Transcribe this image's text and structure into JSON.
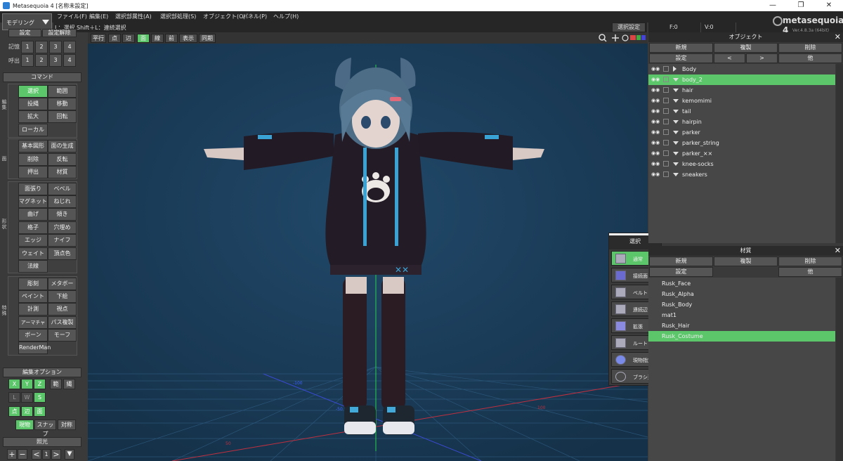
{
  "window": {
    "title": "Metasequoia 4 [名称未設定]",
    "minimize": "—",
    "restore": "❐",
    "close": "✕"
  },
  "menu": [
    "ファイル(F)",
    "編集(E)",
    "選択部属性(A)",
    "選択部処理(S)",
    "オブジェクト(O)",
    "パネル(P)",
    "ヘルプ(H)"
  ],
  "mode": {
    "label": "モデリング"
  },
  "status": {
    "hint": "L：選択  Shift＋L：連続選択",
    "settings_button": "選択設定"
  },
  "frame": {
    "f_label": "F:0",
    "v_label": "V:0"
  },
  "logo": {
    "text": "metasequoia 4",
    "version": "Ver.4.8.3a (64bit)"
  },
  "left": {
    "top_buttons": [
      "設定",
      "設定解除"
    ],
    "memory_label": "記憶",
    "recall_label": "呼出",
    "slots": [
      "1",
      "2",
      "3",
      "4"
    ],
    "command_header": "コマンド",
    "group1_label": "編集",
    "group1": [
      "選択",
      "範囲",
      "投縄",
      "移動",
      "拡大",
      "回転",
      "ローカル"
    ],
    "group2_label": "面",
    "group2": [
      "基本図形",
      "面の生成",
      "削除",
      "反転",
      "押出",
      "材質"
    ],
    "group3_label": "形状",
    "group3": [
      "面張り",
      "ベベル",
      "マグネット",
      "ねじれ",
      "曲げ",
      "傾き",
      "格子",
      "穴埋め",
      "エッジ",
      "ナイフ",
      "ウェイト",
      "頂点色",
      "法線"
    ],
    "group4_label": "特殊",
    "group4": [
      "彫刻",
      "メタボール",
      "ペイント",
      "下絵",
      "計測",
      "視点",
      "アーマチャー",
      "パス複製",
      "ボーン",
      "モーフ",
      "RenderMan"
    ],
    "edit_options_header": "編集オプション",
    "axis": [
      "X",
      "Y",
      "Z",
      "範",
      "縄"
    ],
    "coords": [
      "L",
      "W",
      "S"
    ],
    "targets": [
      "点",
      "辺",
      "面"
    ],
    "options": [
      "現物",
      "スナップ",
      "対称"
    ],
    "light_header": "照光",
    "light_controls": [
      "+",
      "−",
      "<",
      "1",
      ">",
      "▼"
    ]
  },
  "viewport": {
    "toolbar": [
      "平行",
      "点",
      "辺",
      "面",
      "線",
      "前",
      "表示",
      "同期"
    ],
    "axis_labels": [
      "-100",
      "-50",
      "50",
      "100"
    ]
  },
  "select_popup": {
    "title": "選択",
    "options": [
      "通常",
      "接続面",
      "ベルト",
      "連続辺",
      "拡張",
      "ルート",
      "現物指定",
      "ブラシ選択"
    ]
  },
  "object_panel": {
    "title": "オブジェクト",
    "buttons": [
      "新規",
      "複製",
      "削除",
      "設定",
      "<",
      ">",
      "他"
    ],
    "objects": [
      {
        "name": "Body",
        "expanded": false,
        "selected": false
      },
      {
        "name": "body_2",
        "expanded": true,
        "selected": true
      },
      {
        "name": "hair",
        "expanded": true,
        "selected": false
      },
      {
        "name": "kemomimi",
        "expanded": true,
        "selected": false
      },
      {
        "name": "tail",
        "expanded": true,
        "selected": false
      },
      {
        "name": "hairpin",
        "expanded": true,
        "selected": false
      },
      {
        "name": "parker",
        "expanded": true,
        "selected": false
      },
      {
        "name": "parker_string",
        "expanded": true,
        "selected": false
      },
      {
        "name": "parker_××",
        "expanded": true,
        "selected": false
      },
      {
        "name": "knee-socks",
        "expanded": true,
        "selected": false
      },
      {
        "name": "sneakers",
        "expanded": true,
        "selected": false
      }
    ]
  },
  "material_panel": {
    "title": "材質",
    "buttons": [
      "新規",
      "複製",
      "削除",
      "設定",
      "他"
    ],
    "materials": [
      {
        "name": "Rusk_Face",
        "selected": false
      },
      {
        "name": "Rusk_Alpha",
        "selected": false
      },
      {
        "name": "Rusk_Body",
        "selected": false
      },
      {
        "name": "mat1",
        "selected": false
      },
      {
        "name": "Rusk_Hair",
        "selected": false
      },
      {
        "name": "Rusk_Costume",
        "selected": true
      }
    ]
  },
  "colors": {
    "accent": "#5cc66a",
    "viewport_bg": "#1a3c5a",
    "panel_bg": "#3a3a3a"
  }
}
